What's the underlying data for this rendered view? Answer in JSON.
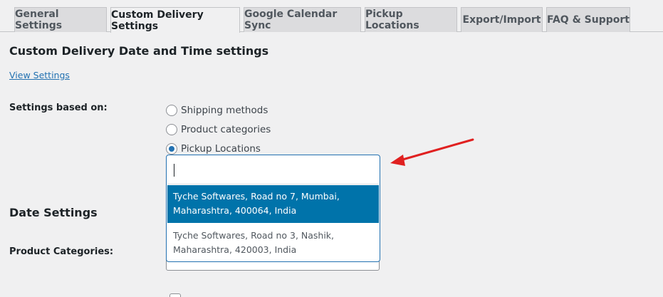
{
  "tabs": [
    {
      "label": "General Settings"
    },
    {
      "label": "Custom Delivery Settings"
    },
    {
      "label": "Google Calendar Sync"
    },
    {
      "label": "Pickup Locations"
    },
    {
      "label": "Export/Import"
    },
    {
      "label": "FAQ & Support"
    }
  ],
  "page": {
    "title": "Custom Delivery Date and Time settings",
    "view_settings_link": "View Settings"
  },
  "settings_based_on": {
    "label": "Settings based on:",
    "options": [
      {
        "label": "Shipping methods",
        "checked": false
      },
      {
        "label": "Product categories",
        "checked": false
      },
      {
        "label": "Pickup Locations",
        "checked": true
      }
    ]
  },
  "dropdown": {
    "search_value": "",
    "options": [
      {
        "line1": "Tyche Softwares, Road no 7, Mumbai,",
        "line2": "Maharashtra, 400064, India",
        "highlighted": true
      },
      {
        "line1": "Tyche Softwares, Road no 3, Nashik,",
        "line2": "Maharashtra, 420003, India",
        "highlighted": false
      }
    ]
  },
  "date_settings": {
    "title": "Date Settings",
    "product_categories_label": "Product Categories:"
  },
  "colors": {
    "accent": "#2271b1",
    "highlight": "#0073aa",
    "annotation_arrow": "#e02020",
    "background": "#f0f0f1"
  }
}
